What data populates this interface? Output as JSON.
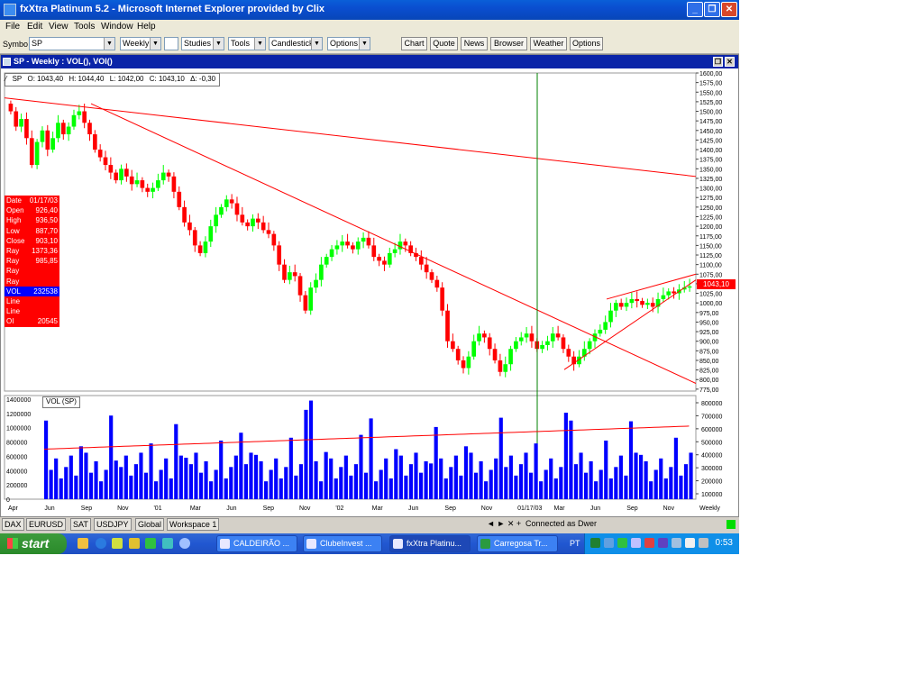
{
  "window": {
    "title": "fxXtra Platinum 5.2 - Microsoft Internet Explorer provided by Clix"
  },
  "menu": [
    "File",
    "Edit",
    "View",
    "Tools",
    "Window",
    "Help"
  ],
  "toolbar": {
    "symbol_label": "Symbo",
    "symbol_value": "SP",
    "period": "Weekly",
    "studies": "Studies",
    "tools": "Tools",
    "chart_style": "Candlestick",
    "options": "Options",
    "buttons": [
      "Chart",
      "Quote",
      "News",
      "Browser",
      "Weather",
      "Options"
    ]
  },
  "chart_window": {
    "title": "SP - Weekly : VOL(), VOI()"
  },
  "ohlc_bar": {
    "symbol": "SP",
    "open": "O: 1043,40",
    "high": "H: 1044,40",
    "low": "L: 1042,00",
    "close": "C: 1043,10",
    "change": "Δ: -0,30"
  },
  "info_panel": [
    {
      "k": "Date",
      "v": "01/17/03"
    },
    {
      "k": "Open",
      "v": "926,40"
    },
    {
      "k": "High",
      "v": "936,50"
    },
    {
      "k": "Low",
      "v": "887,70"
    },
    {
      "k": "Close",
      "v": "903,10"
    },
    {
      "k": "Ray",
      "v": "1373,36"
    },
    {
      "k": "Ray",
      "v": "985,85"
    },
    {
      "k": "Ray",
      "v": ""
    },
    {
      "k": "Ray",
      "v": ""
    },
    {
      "k": "VOL",
      "v": "232538"
    },
    {
      "k": "Line",
      "v": ""
    },
    {
      "k": "Line",
      "v": ""
    },
    {
      "k": "OI",
      "v": "20545"
    }
  ],
  "last_price_tag": "1043,10",
  "volume_label": "VOL (SP)",
  "chart_data": [
    {
      "type": "candlestick",
      "title": "SP - Weekly",
      "y_ticks": [
        "1600,00",
        "1575,00",
        "1550,00",
        "1525,00",
        "1500,00",
        "1475,00",
        "1450,00",
        "1425,00",
        "1400,00",
        "1375,00",
        "1350,00",
        "1325,00",
        "1300,00",
        "1275,00",
        "1250,00",
        "1225,00",
        "1200,00",
        "1175,00",
        "1150,00",
        "1125,00",
        "1100,00",
        "1075,00",
        "1050,00",
        "1025,00",
        "1000,00",
        "975,00",
        "950,00",
        "925,00",
        "900,00",
        "875,00",
        "850,00",
        "825,00",
        "800,00",
        "775,00"
      ],
      "ylim": [
        770,
        1600
      ],
      "x_ticks": [
        "Apr",
        "Jun",
        "Sep",
        "Nov",
        "'01",
        "Mar",
        "Jun",
        "Sep",
        "Nov",
        "'02",
        "Mar",
        "Jun",
        "Sep",
        "Nov",
        "01/17/03",
        "Mar",
        "Jun",
        "Sep",
        "Nov",
        "Weekly"
      ],
      "closes": [
        1500,
        1460,
        1480,
        1430,
        1360,
        1420,
        1450,
        1400,
        1430,
        1470,
        1440,
        1460,
        1490,
        1500,
        1470,
        1440,
        1400,
        1380,
        1360,
        1340,
        1320,
        1350,
        1330,
        1310,
        1320,
        1300,
        1290,
        1300,
        1320,
        1340,
        1330,
        1290,
        1250,
        1210,
        1190,
        1150,
        1130,
        1160,
        1200,
        1230,
        1250,
        1270,
        1260,
        1230,
        1210,
        1200,
        1220,
        1210,
        1190,
        1180,
        1150,
        1100,
        1060,
        1080,
        1070,
        1020,
        980,
        1040,
        1060,
        1100,
        1120,
        1140,
        1150,
        1160,
        1150,
        1140,
        1160,
        1170,
        1150,
        1120,
        1110,
        1100,
        1130,
        1140,
        1160,
        1150,
        1130,
        1120,
        1100,
        1080,
        1060,
        1040,
        980,
        900,
        880,
        850,
        830,
        860,
        900,
        920,
        910,
        880,
        850,
        820,
        840,
        880,
        900,
        910,
        920,
        900,
        880,
        890,
        900,
        920,
        910,
        880,
        860,
        840,
        860,
        880,
        900,
        920,
        930,
        950,
        980,
        1000,
        990,
        1000,
        1010,
        1005,
        995,
        1000,
        990,
        1010,
        1020,
        1030,
        1025,
        1035,
        1040,
        1043
      ]
    },
    {
      "type": "bar",
      "title": "VOL (SP)",
      "y_ticks": [
        "1400000",
        "1200000",
        "1000000",
        "800000",
        "600000",
        "400000",
        "200000",
        "0"
      ],
      "ylim": [
        0,
        1450000
      ],
      "right_ticks": [
        "800000",
        "700000",
        "600000",
        "500000",
        "400000",
        "300000",
        "200000",
        "100000"
      ]
    }
  ],
  "workspace_tabs": [
    "DAX",
    "EURUSD",
    "SAT",
    "USDJPY",
    "Global",
    "Workspace 1"
  ],
  "nav_arrows": "◄ ► ✕ +",
  "status": "Connected as Dwer",
  "taskbar": {
    "start": "start",
    "tasks": [
      "CALDEIRÃO ...",
      "ClubeInvest ...",
      "fxXtra Platinu...",
      "Carregosa Tr..."
    ],
    "lang": "PT",
    "clock": "0:53"
  },
  "colors": {
    "up": "#00ff00",
    "down": "#ff0000",
    "volume": "#0000ff",
    "trend": "#ff0000",
    "cursor": "#008000",
    "titlebar": "#0a4ed0",
    "infobox": "#ff0000"
  }
}
